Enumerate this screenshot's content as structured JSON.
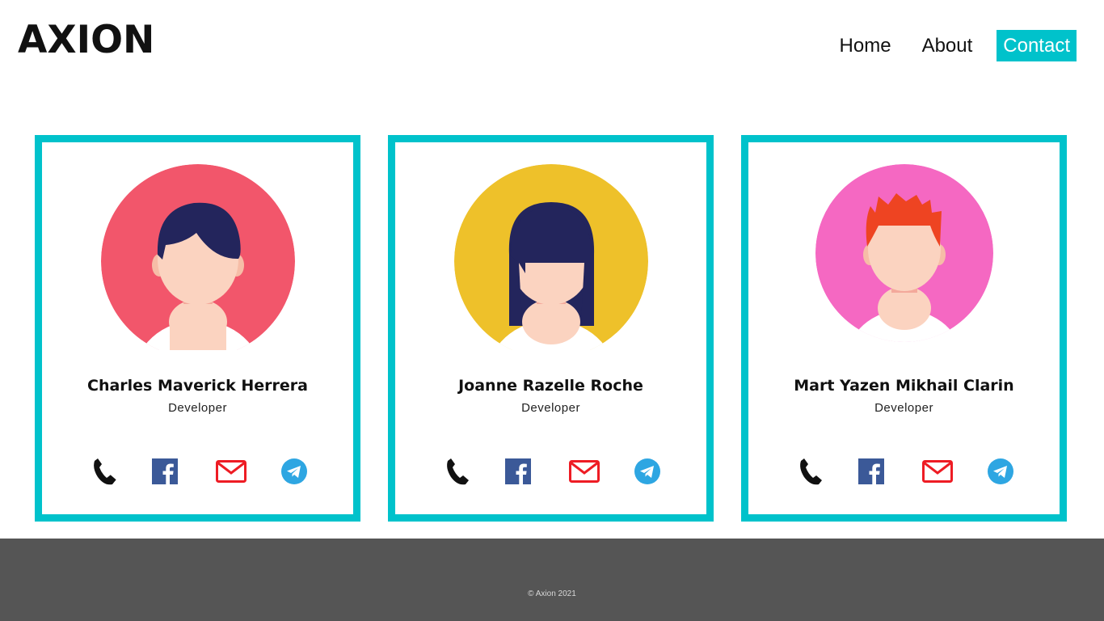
{
  "header": {
    "logo": "AXION",
    "nav": [
      {
        "label": "Home",
        "active": false
      },
      {
        "label": "About",
        "active": false
      },
      {
        "label": "Contact",
        "active": true
      }
    ]
  },
  "team": [
    {
      "name": "Charles Maverick Herrera",
      "role": "Developer",
      "avatar_bg": "#f2566b",
      "hair_color": "#23255c",
      "avatar": "short-hair-man"
    },
    {
      "name": "Joanne Razelle Roche",
      "role": "Developer",
      "avatar_bg": "#eec12a",
      "hair_color": "#23255c",
      "avatar": "long-hair-woman"
    },
    {
      "name": "Mart Yazen Mikhail Clarin",
      "role": "Developer",
      "avatar_bg": "#f568c2",
      "hair_color": "#ee4422",
      "avatar": "spiky-hair-man"
    }
  ],
  "social_icons": [
    "phone-icon",
    "facebook-icon",
    "email-icon",
    "telegram-icon"
  ],
  "footer": {
    "copyright": "© Axion 2021"
  },
  "colors": {
    "accent": "#00c2cb",
    "footer_bg": "#555555",
    "skin": "#fbd3c0",
    "facebook": "#3b5998",
    "mail": "#ee1c24",
    "telegram": "#2ea6e2"
  }
}
